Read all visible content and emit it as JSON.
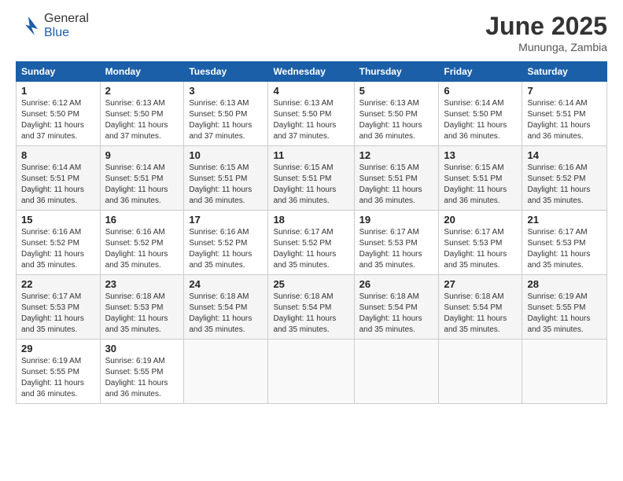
{
  "logo": {
    "general": "General",
    "blue": "Blue"
  },
  "title": {
    "month": "June 2025",
    "location": "Mununga, Zambia"
  },
  "headers": [
    "Sunday",
    "Monday",
    "Tuesday",
    "Wednesday",
    "Thursday",
    "Friday",
    "Saturday"
  ],
  "weeks": [
    [
      {
        "day": "1",
        "sunrise": "6:12 AM",
        "sunset": "5:50 PM",
        "hours": "11 hours",
        "minutes": "37 minutes"
      },
      {
        "day": "2",
        "sunrise": "6:13 AM",
        "sunset": "5:50 PM",
        "hours": "11 hours",
        "minutes": "37 minutes"
      },
      {
        "day": "3",
        "sunrise": "6:13 AM",
        "sunset": "5:50 PM",
        "hours": "11 hours",
        "minutes": "37 minutes"
      },
      {
        "day": "4",
        "sunrise": "6:13 AM",
        "sunset": "5:50 PM",
        "hours": "11 hours",
        "minutes": "37 minutes"
      },
      {
        "day": "5",
        "sunrise": "6:13 AM",
        "sunset": "5:50 PM",
        "hours": "11 hours",
        "minutes": "36 minutes"
      },
      {
        "day": "6",
        "sunrise": "6:14 AM",
        "sunset": "5:50 PM",
        "hours": "11 hours",
        "minutes": "36 minutes"
      },
      {
        "day": "7",
        "sunrise": "6:14 AM",
        "sunset": "5:51 PM",
        "hours": "11 hours",
        "minutes": "36 minutes"
      }
    ],
    [
      {
        "day": "8",
        "sunrise": "6:14 AM",
        "sunset": "5:51 PM",
        "hours": "11 hours",
        "minutes": "36 minutes"
      },
      {
        "day": "9",
        "sunrise": "6:14 AM",
        "sunset": "5:51 PM",
        "hours": "11 hours",
        "minutes": "36 minutes"
      },
      {
        "day": "10",
        "sunrise": "6:15 AM",
        "sunset": "5:51 PM",
        "hours": "11 hours",
        "minutes": "36 minutes"
      },
      {
        "day": "11",
        "sunrise": "6:15 AM",
        "sunset": "5:51 PM",
        "hours": "11 hours",
        "minutes": "36 minutes"
      },
      {
        "day": "12",
        "sunrise": "6:15 AM",
        "sunset": "5:51 PM",
        "hours": "11 hours",
        "minutes": "36 minutes"
      },
      {
        "day": "13",
        "sunrise": "6:15 AM",
        "sunset": "5:51 PM",
        "hours": "11 hours",
        "minutes": "36 minutes"
      },
      {
        "day": "14",
        "sunrise": "6:16 AM",
        "sunset": "5:52 PM",
        "hours": "11 hours",
        "minutes": "35 minutes"
      }
    ],
    [
      {
        "day": "15",
        "sunrise": "6:16 AM",
        "sunset": "5:52 PM",
        "hours": "11 hours",
        "minutes": "35 minutes"
      },
      {
        "day": "16",
        "sunrise": "6:16 AM",
        "sunset": "5:52 PM",
        "hours": "11 hours",
        "minutes": "35 minutes"
      },
      {
        "day": "17",
        "sunrise": "6:16 AM",
        "sunset": "5:52 PM",
        "hours": "11 hours",
        "minutes": "35 minutes"
      },
      {
        "day": "18",
        "sunrise": "6:17 AM",
        "sunset": "5:52 PM",
        "hours": "11 hours",
        "minutes": "35 minutes"
      },
      {
        "day": "19",
        "sunrise": "6:17 AM",
        "sunset": "5:53 PM",
        "hours": "11 hours",
        "minutes": "35 minutes"
      },
      {
        "day": "20",
        "sunrise": "6:17 AM",
        "sunset": "5:53 PM",
        "hours": "11 hours",
        "minutes": "35 minutes"
      },
      {
        "day": "21",
        "sunrise": "6:17 AM",
        "sunset": "5:53 PM",
        "hours": "11 hours",
        "minutes": "35 minutes"
      }
    ],
    [
      {
        "day": "22",
        "sunrise": "6:17 AM",
        "sunset": "5:53 PM",
        "hours": "11 hours",
        "minutes": "35 minutes"
      },
      {
        "day": "23",
        "sunrise": "6:18 AM",
        "sunset": "5:53 PM",
        "hours": "11 hours",
        "minutes": "35 minutes"
      },
      {
        "day": "24",
        "sunrise": "6:18 AM",
        "sunset": "5:54 PM",
        "hours": "11 hours",
        "minutes": "35 minutes"
      },
      {
        "day": "25",
        "sunrise": "6:18 AM",
        "sunset": "5:54 PM",
        "hours": "11 hours",
        "minutes": "35 minutes"
      },
      {
        "day": "26",
        "sunrise": "6:18 AM",
        "sunset": "5:54 PM",
        "hours": "11 hours",
        "minutes": "35 minutes"
      },
      {
        "day": "27",
        "sunrise": "6:18 AM",
        "sunset": "5:54 PM",
        "hours": "11 hours",
        "minutes": "35 minutes"
      },
      {
        "day": "28",
        "sunrise": "6:19 AM",
        "sunset": "5:55 PM",
        "hours": "11 hours",
        "minutes": "35 minutes"
      }
    ],
    [
      {
        "day": "29",
        "sunrise": "6:19 AM",
        "sunset": "5:55 PM",
        "hours": "11 hours",
        "minutes": "36 minutes"
      },
      {
        "day": "30",
        "sunrise": "6:19 AM",
        "sunset": "5:55 PM",
        "hours": "11 hours",
        "minutes": "36 minutes"
      },
      null,
      null,
      null,
      null,
      null
    ]
  ],
  "labels": {
    "sunrise": "Sunrise:",
    "sunset": "Sunset:",
    "daylight": "Daylight:"
  }
}
